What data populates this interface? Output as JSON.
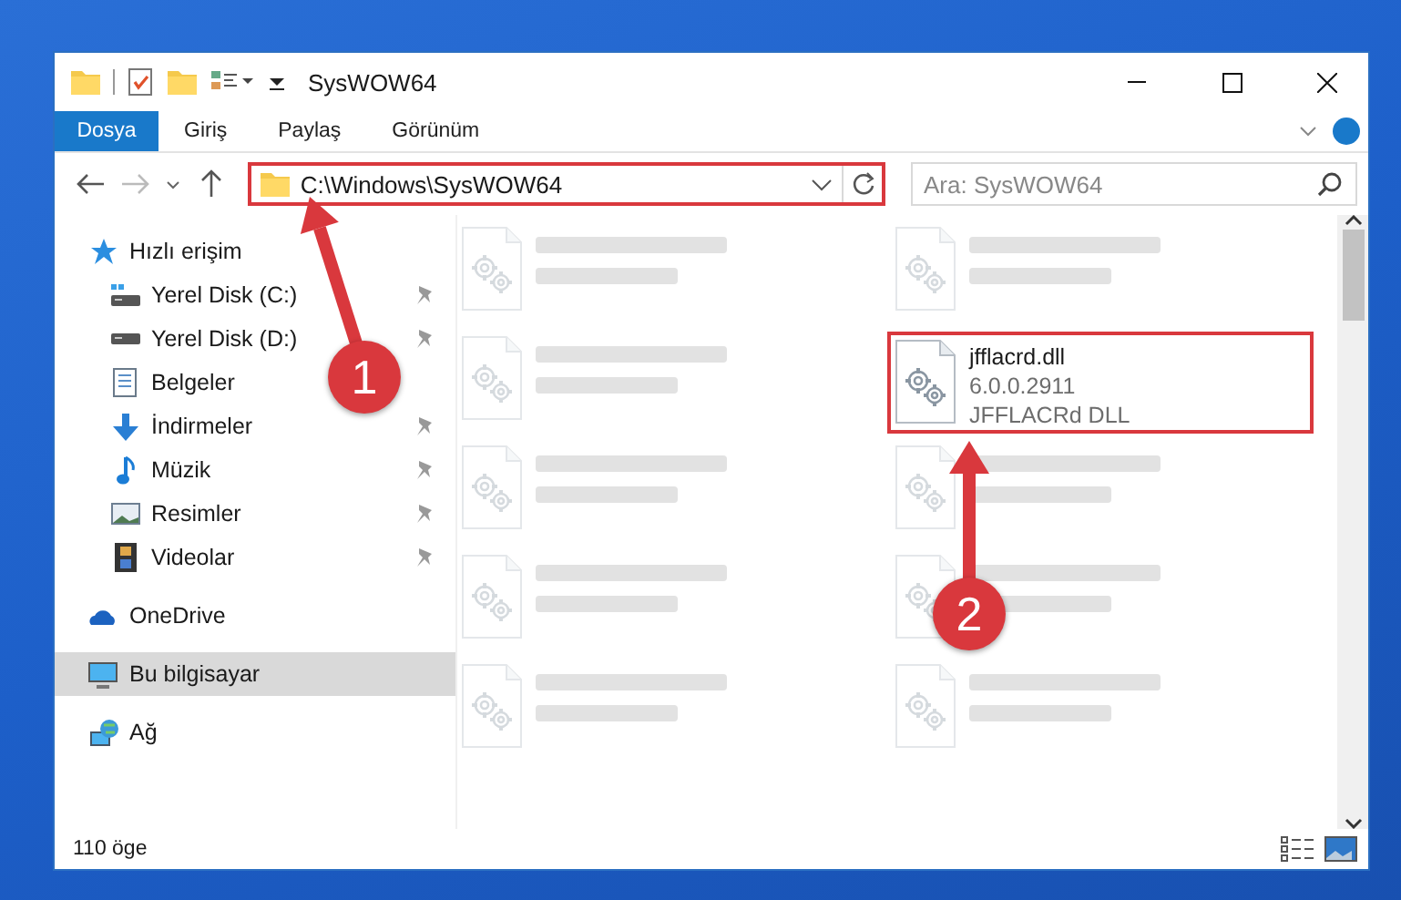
{
  "window": {
    "title": "SysWOW64"
  },
  "ribbon": {
    "tabs": [
      {
        "label": "Dosya",
        "kind": "file"
      },
      {
        "label": "Giriş",
        "kind": "tab"
      },
      {
        "label": "Paylaş",
        "kind": "tab"
      },
      {
        "label": "Görünüm",
        "kind": "tab"
      }
    ]
  },
  "address": {
    "path": "C:\\Windows\\SysWOW64",
    "highlighted": true
  },
  "search": {
    "placeholder": "Ara: SysWOW64"
  },
  "sidebar": {
    "items": [
      {
        "label": "Hızlı erişim",
        "selected": false,
        "children": [
          {
            "label": "Yerel Disk (C:)",
            "pinned": true,
            "selected": false
          },
          {
            "label": "Yerel Disk (D:)",
            "pinned": true,
            "selected": false
          },
          {
            "label": "Belgeler",
            "pinned": false,
            "selected": false
          },
          {
            "label": "İndirmeler",
            "pinned": true,
            "selected": false
          },
          {
            "label": "Müzik",
            "pinned": true,
            "selected": false
          },
          {
            "label": "Resimler",
            "pinned": true,
            "selected": false
          },
          {
            "label": "Videolar",
            "pinned": true,
            "selected": false
          }
        ]
      },
      {
        "label": "OneDrive",
        "selected": false
      },
      {
        "label": "Bu bilgisayar",
        "selected": true
      },
      {
        "label": "Ağ",
        "selected": false
      }
    ]
  },
  "files": [
    {
      "kind": "blurred"
    },
    {
      "kind": "blurred"
    },
    {
      "kind": "blurred"
    },
    {
      "kind": "file",
      "name": "jfflacrd.dll",
      "lines": [
        "6.0.0.2911",
        "JFFLACRd DLL"
      ],
      "highlighted": true
    },
    {
      "kind": "blurred"
    },
    {
      "kind": "blurred"
    },
    {
      "kind": "blurred"
    },
    {
      "kind": "blurred"
    },
    {
      "kind": "blurred"
    },
    {
      "kind": "blurred"
    }
  ],
  "status_bar": {
    "count": "110 öge"
  },
  "annotations": [
    {
      "number": "1"
    },
    {
      "number": "2"
    }
  ]
}
